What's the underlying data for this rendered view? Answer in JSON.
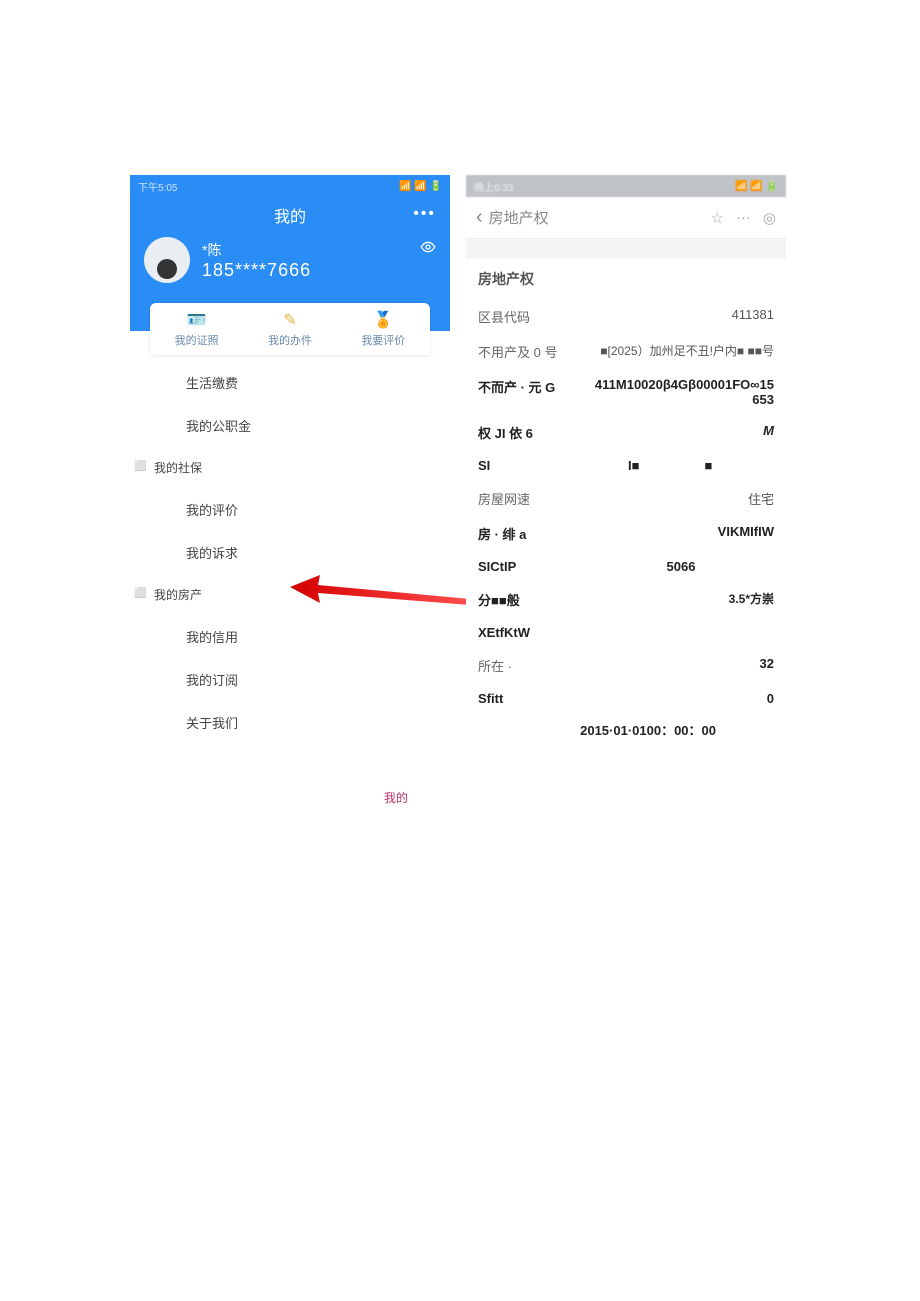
{
  "left": {
    "status": {
      "time": "下午5:05",
      "icons_l": "📶 🟦 🟧 ▲ ···",
      "icons_r": "📶 📶 🔋"
    },
    "header": {
      "title": "我的",
      "more": "•••",
      "avatar_name": "*陈",
      "avatar_num": "185****7666"
    },
    "tabs": [
      {
        "label": "我的证照",
        "icon": "card-icon",
        "glyph": "🪪"
      },
      {
        "label": "我的办件",
        "icon": "pencil-icon",
        "glyph": "✎"
      },
      {
        "label": "我要评价",
        "icon": "badge-icon",
        "glyph": "🏅"
      }
    ],
    "menu": [
      {
        "label": "生活缴费",
        "icon": ""
      },
      {
        "label": "我的公职金",
        "icon": ""
      },
      {
        "label": "我的社保",
        "icon": "tiny",
        "variant": "indent-less"
      },
      {
        "label": "我的评价",
        "icon": ""
      },
      {
        "label": "我的诉求",
        "icon": ""
      },
      {
        "label": "我的房产",
        "icon": "tiny",
        "variant": "indent-less"
      },
      {
        "label": "我的信用",
        "icon": ""
      },
      {
        "label": "我的订阅",
        "icon": ""
      },
      {
        "label": "关于我们",
        "icon": ""
      }
    ],
    "footer": "我的"
  },
  "right": {
    "status": {
      "time": "晚上6:33",
      "icons_l": "🟨 🟦 ⬛ ···",
      "icons_r": "📶 📶 🔋"
    },
    "nav": {
      "back": "‹",
      "title": "房地产权",
      "star": "☆",
      "more": "···",
      "target": "◎"
    },
    "section_title": "房地产权",
    "rows": [
      {
        "label": "区县代码",
        "value": "411381",
        "gray": true
      },
      {
        "label": "不用产及 0 号",
        "value": "■[2025）加州足不丑!户内■ ■■号"
      },
      {
        "label": "不而产 · 元 G",
        "value": "411M10020β4Gβ00001FO∞15653",
        "bold": true
      },
      {
        "label": "权 JI 依 6",
        "value": "M",
        "bold": true,
        "italic": true
      },
      {
        "label": "SI",
        "value": "I■     ■",
        "bold": true
      },
      {
        "label": "房屋网速",
        "value": "住宅"
      },
      {
        "label": "房 · 绯 a",
        "value": "VIKMIfIW",
        "bold": true
      },
      {
        "label": "SICtIP",
        "value": "5066",
        "bold": true,
        "valueLight": false
      },
      {
        "label": "分■■般",
        "value": "3.5*方崇",
        "bold": true
      },
      {
        "label": "XEtfKtW",
        "value": "",
        "bold": true
      },
      {
        "label": "所在 ·",
        "value": "32",
        "bold": true
      },
      {
        "label": "Sfitt",
        "value": "0",
        "bold": true
      }
    ],
    "timestamp": "2015·01·0100：00：00"
  }
}
